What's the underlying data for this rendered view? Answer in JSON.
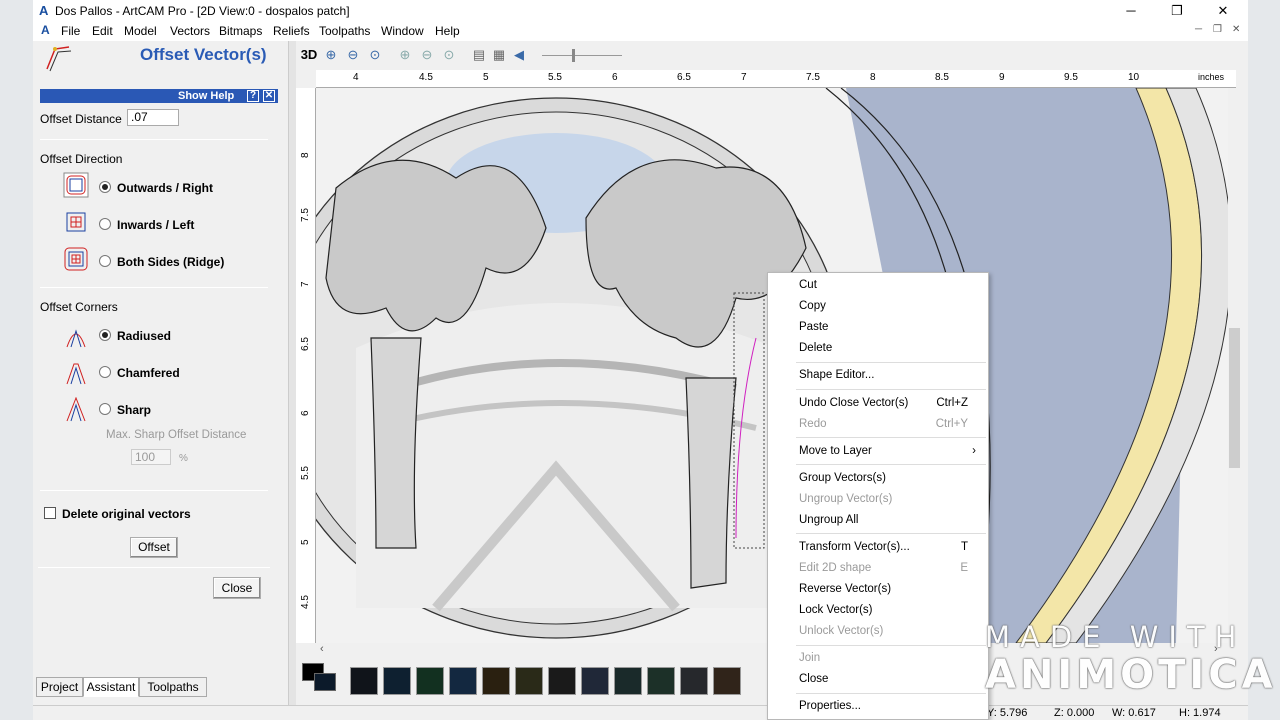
{
  "window": {
    "title": "Dos Pallos - ArtCAM Pro - [2D View:0 - dospalos patch]",
    "app_icon": "artcam-logo-icon",
    "controls": [
      "─",
      "❐",
      "✕"
    ],
    "mdi_controls": [
      "─",
      "❐",
      "✕"
    ]
  },
  "menu": [
    "File",
    "Edit",
    "Model",
    "Vectors",
    "Bitmaps",
    "Reliefs",
    "Toolpaths",
    "Window",
    "Help"
  ],
  "panel": {
    "title": "Offset Vector(s)",
    "help": {
      "label": "Show Help",
      "q": "?",
      "x": "✕"
    },
    "offset_distance": {
      "label": "Offset Distance",
      "value": ".07"
    },
    "direction": {
      "heading": "Offset Direction",
      "options": [
        {
          "label": "Outwards / Right",
          "selected": true
        },
        {
          "label": "Inwards / Left",
          "selected": false
        },
        {
          "label": "Both Sides (Ridge)",
          "selected": false
        }
      ]
    },
    "corners": {
      "heading": "Offset Corners",
      "options": [
        {
          "label": "Radiused",
          "selected": true
        },
        {
          "label": "Chamfered",
          "selected": false
        },
        {
          "label": "Sharp",
          "selected": false
        }
      ],
      "max_sharp": {
        "label": "Max. Sharp Offset Distance",
        "value": "100",
        "unit": "%"
      }
    },
    "delete_original": {
      "label": "Delete original vectors",
      "checked": false
    },
    "offset_button": "Offset",
    "close_button": "Close",
    "tabs": [
      "Project",
      "Assistant",
      "Toolpaths"
    ],
    "active_tab": "Assistant"
  },
  "view": {
    "toolbar_3d": "3D",
    "ruler_units": "inches",
    "ruler_top": [
      "4",
      "4.5",
      "5",
      "5.5",
      "6",
      "6.5",
      "7",
      "7.5",
      "8",
      "8.5",
      "9",
      "9.5",
      "10"
    ],
    "ruler_left": [
      "8",
      "7.5",
      "7",
      "6.5",
      "6",
      "5.5",
      "5",
      "4.5"
    ]
  },
  "palette": {
    "colors": [
      "#000000",
      "#10141a",
      "#0e2030",
      "#123020",
      "#132840",
      "#2a2010",
      "#2a2a18",
      "#1a1a1a",
      "#202838",
      "#1a2a2a",
      "#1c3028",
      "#26282c",
      "#30241a"
    ]
  },
  "status": {
    "y": "Y: 5.796",
    "z": "Z: 0.000",
    "w": "W: 0.617",
    "h": "H: 1.974"
  },
  "context_menu": {
    "items": [
      {
        "label": "Cut",
        "shortcut": "",
        "disabled": false
      },
      {
        "label": "Copy",
        "shortcut": "",
        "disabled": false
      },
      {
        "label": "Paste",
        "shortcut": "",
        "disabled": false
      },
      {
        "label": "Delete",
        "shortcut": "",
        "disabled": false
      },
      {
        "label": "Shape Editor...",
        "shortcut": "",
        "disabled": false
      },
      {
        "label": "Undo Close Vector(s)",
        "shortcut": "Ctrl+Z",
        "disabled": false
      },
      {
        "label": "Redo",
        "shortcut": "Ctrl+Y",
        "disabled": true
      },
      {
        "label": "Move to Layer",
        "shortcut": "›",
        "disabled": false
      },
      {
        "label": "Group Vectors(s)",
        "shortcut": "",
        "disabled": false
      },
      {
        "label": "Ungroup Vector(s)",
        "shortcut": "",
        "disabled": true
      },
      {
        "label": "Ungroup All",
        "shortcut": "",
        "disabled": false
      },
      {
        "label": "Transform Vector(s)...",
        "shortcut": "T",
        "disabled": false
      },
      {
        "label": "Edit 2D shape",
        "shortcut": "E",
        "disabled": true
      },
      {
        "label": "Reverse Vector(s)",
        "shortcut": "",
        "disabled": false
      },
      {
        "label": "Lock Vector(s)",
        "shortcut": "",
        "disabled": false
      },
      {
        "label": "Unlock Vector(s)",
        "shortcut": "",
        "disabled": true
      },
      {
        "label": "Join",
        "shortcut": "",
        "disabled": true
      },
      {
        "label": "Close",
        "shortcut": "",
        "disabled": false
      },
      {
        "label": "Properties...",
        "shortcut": "",
        "disabled": false
      }
    ]
  },
  "watermark": {
    "line1": "MADE WITH",
    "line2": "ANIMOTICA"
  }
}
